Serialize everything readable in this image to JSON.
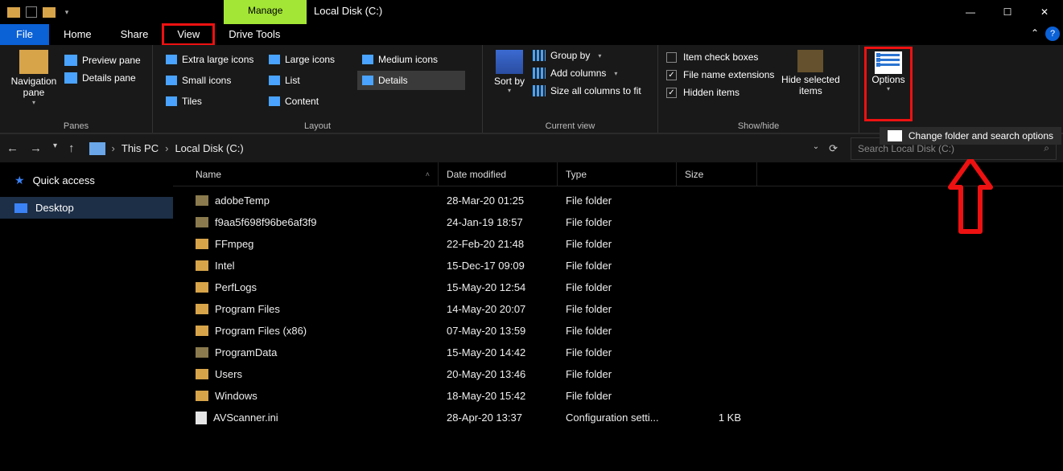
{
  "titlebar": {
    "manage_label": "Manage",
    "title": "Local Disk (C:)"
  },
  "tabs": {
    "file": "File",
    "home": "Home",
    "share": "Share",
    "view": "View",
    "drive_tools": "Drive Tools"
  },
  "ribbon": {
    "panes": {
      "navigation": "Navigation pane",
      "preview": "Preview pane",
      "details": "Details pane",
      "group_label": "Panes"
    },
    "layout": {
      "extra_large": "Extra large icons",
      "large": "Large icons",
      "medium": "Medium icons",
      "small": "Small icons",
      "list": "List",
      "details": "Details",
      "tiles": "Tiles",
      "content": "Content",
      "group_label": "Layout"
    },
    "current_view": {
      "sort": "Sort by",
      "group_by": "Group by",
      "add_columns": "Add columns",
      "size_all": "Size all columns to fit",
      "group_label": "Current view"
    },
    "show_hide": {
      "item_check": "Item check boxes",
      "file_ext": "File name extensions",
      "hidden": "Hidden items",
      "hide_selected": "Hide selected items",
      "group_label": "Show/hide"
    },
    "options": {
      "label": "Options",
      "dropdown_item": "Change folder and search options"
    }
  },
  "breadcrumb": {
    "this_pc": "This PC",
    "disk": "Local Disk (C:)"
  },
  "search": {
    "placeholder": "Search Local Disk (C:)"
  },
  "sidebar": {
    "quick_access": "Quick access",
    "desktop": "Desktop"
  },
  "columns": {
    "name": "Name",
    "date": "Date modified",
    "type": "Type",
    "size": "Size"
  },
  "rows": [
    {
      "icon": "dim",
      "name": "adobeTemp",
      "date": "28-Mar-20 01:25",
      "type": "File folder",
      "size": ""
    },
    {
      "icon": "dim",
      "name": "f9aa5f698f96be6af3f9",
      "date": "24-Jan-19 18:57",
      "type": "File folder",
      "size": ""
    },
    {
      "icon": "folder",
      "name": "FFmpeg",
      "date": "22-Feb-20 21:48",
      "type": "File folder",
      "size": ""
    },
    {
      "icon": "folder",
      "name": "Intel",
      "date": "15-Dec-17 09:09",
      "type": "File folder",
      "size": ""
    },
    {
      "icon": "folder",
      "name": "PerfLogs",
      "date": "15-May-20 12:54",
      "type": "File folder",
      "size": ""
    },
    {
      "icon": "folder",
      "name": "Program Files",
      "date": "14-May-20 20:07",
      "type": "File folder",
      "size": ""
    },
    {
      "icon": "folder",
      "name": "Program Files (x86)",
      "date": "07-May-20 13:59",
      "type": "File folder",
      "size": ""
    },
    {
      "icon": "dim",
      "name": "ProgramData",
      "date": "15-May-20 14:42",
      "type": "File folder",
      "size": ""
    },
    {
      "icon": "folder",
      "name": "Users",
      "date": "20-May-20 13:46",
      "type": "File folder",
      "size": ""
    },
    {
      "icon": "folder",
      "name": "Windows",
      "date": "18-May-20 15:42",
      "type": "File folder",
      "size": ""
    },
    {
      "icon": "file",
      "name": "AVScanner.ini",
      "date": "28-Apr-20 13:37",
      "type": "Configuration setti...",
      "size": "1 KB"
    }
  ]
}
